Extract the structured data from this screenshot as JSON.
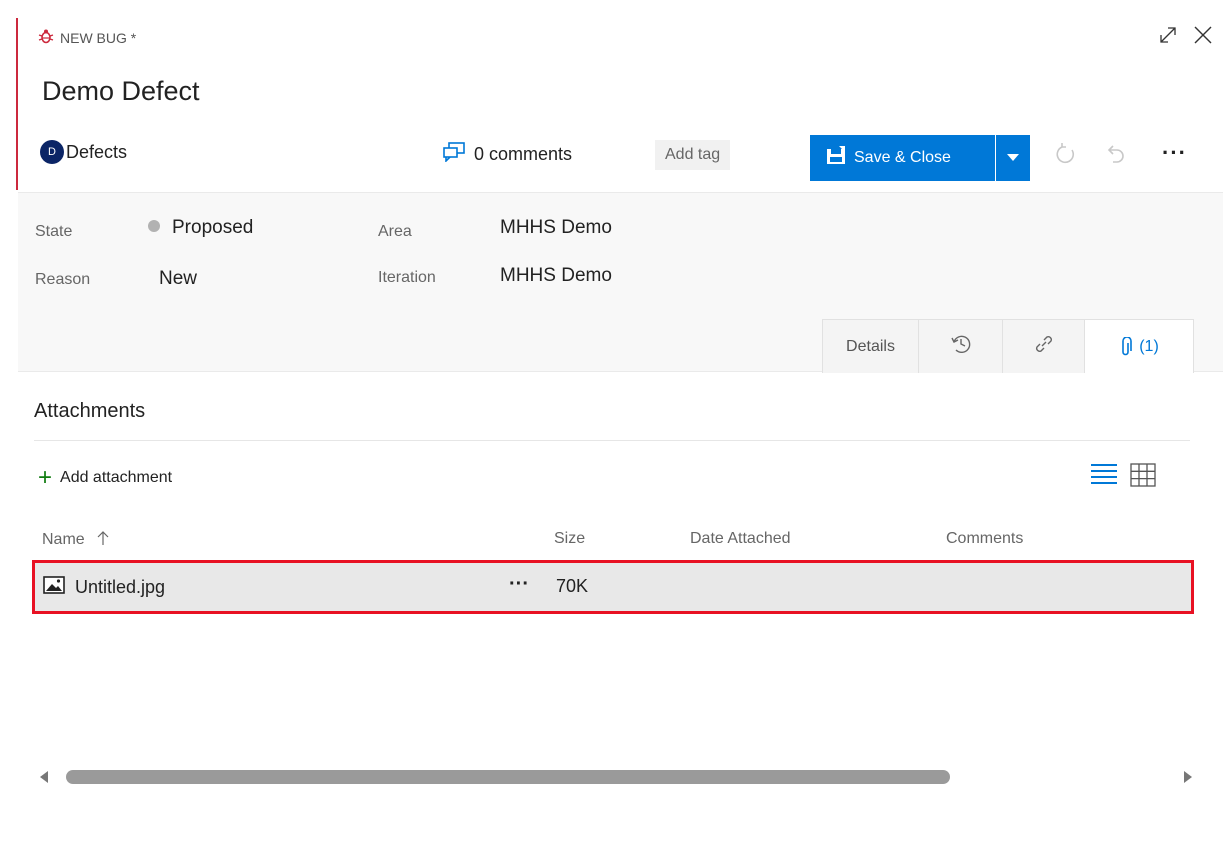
{
  "header": {
    "type_label": "NEW BUG *",
    "title": "Demo Defect",
    "team_avatar_letter": "D",
    "team_name": "Defects",
    "comments_label": "0 comments",
    "add_tag_label": "Add tag",
    "save_close_label": "Save & Close"
  },
  "fields": {
    "state_label": "State",
    "state_value": "Proposed",
    "reason_label": "Reason",
    "reason_value": "New",
    "area_label": "Area",
    "area_value": "MHHS Demo",
    "iteration_label": "Iteration",
    "iteration_value": "MHHS Demo"
  },
  "tabs": {
    "details_label": "Details",
    "attachments_count": "(1)"
  },
  "attachments": {
    "title": "Attachments",
    "add_label": "Add attachment",
    "columns": {
      "name": "Name",
      "size": "Size",
      "date": "Date Attached",
      "comments": "Comments"
    },
    "rows": [
      {
        "name": "Untitled.jpg",
        "size": "70K",
        "date": "",
        "comments": ""
      }
    ]
  },
  "colors": {
    "accent": "#0078d7",
    "bug_red": "#cc293d",
    "highlight_border": "#e81123",
    "state_dot": "#b2b2b2"
  },
  "icons": [
    "bug-icon",
    "expand-icon",
    "close-icon",
    "comment-icon",
    "save-icon",
    "chevron-down-icon",
    "refresh-icon",
    "undo-icon",
    "history-icon",
    "link-icon",
    "paperclip-icon",
    "image-file-icon",
    "list-view-icon",
    "grid-view-icon"
  ]
}
